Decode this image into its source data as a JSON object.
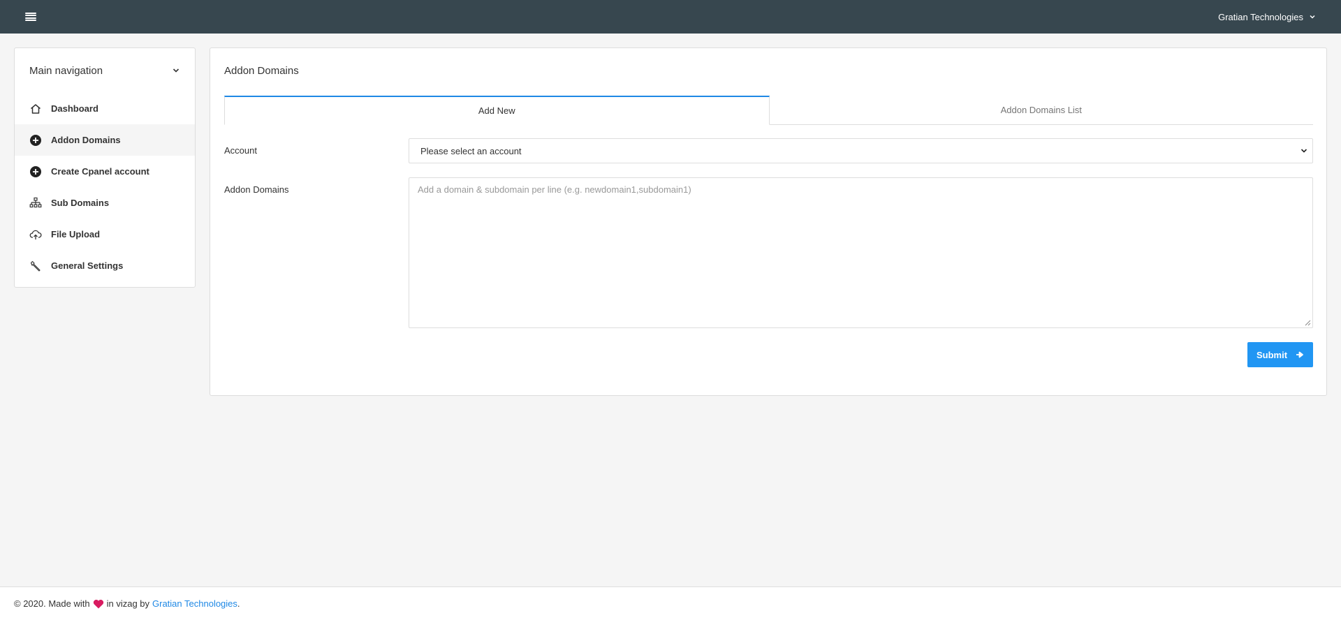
{
  "header": {
    "menu_icon": "hamburger-menu-icon",
    "user_name": "Gratian Technologies",
    "user_chevron_icon": "chevron-down-icon"
  },
  "sidebar": {
    "title": "Main navigation",
    "collapse_icon": "chevron-down-icon",
    "items": [
      {
        "label": "Dashboard",
        "icon": "home-icon",
        "active": false
      },
      {
        "label": "Addon Domains",
        "icon": "plus-circle-icon",
        "active": true
      },
      {
        "label": "Create Cpanel account",
        "icon": "plus-circle-icon",
        "active": false
      },
      {
        "label": "Sub Domains",
        "icon": "sitemap-icon",
        "active": false
      },
      {
        "label": "File Upload",
        "icon": "cloud-upload-icon",
        "active": false
      },
      {
        "label": "General Settings",
        "icon": "wrench-icon",
        "active": false
      }
    ]
  },
  "main": {
    "card_title": "Addon Domains",
    "tabs": [
      {
        "label": "Add New",
        "active": true
      },
      {
        "label": "Addon Domains List",
        "active": false
      }
    ],
    "form": {
      "account_label": "Account",
      "account_selected": "Please select an account",
      "domains_label": "Addon Domains",
      "domains_placeholder": "Add a domain & subdomain per line (e.g. newdomain1,subdomain1)",
      "domains_value": "",
      "submit_label": "Submit",
      "submit_icon": "arrow-right-icon"
    }
  },
  "footer": {
    "prefix": "© 2020. Made with",
    "heart_icon": "heart-icon",
    "middle": "in vizag by",
    "link_text": "Gratian Technologies",
    "suffix": "."
  },
  "colors": {
    "topbar": "#37474f",
    "accent": "#2196f3",
    "tab_active_border": "#1e88e5",
    "heart": "#d81b60",
    "link": "#1e88e5"
  }
}
